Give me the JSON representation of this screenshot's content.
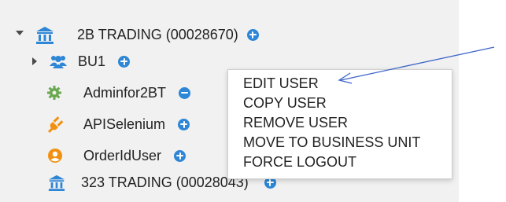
{
  "tree": {
    "company1": {
      "label": "2B TRADING (00028670)",
      "icon": "bank-icon",
      "expanded": true,
      "children": {
        "bu1": {
          "label": "BU1",
          "icon": "users-group-icon",
          "expanded": false
        },
        "user_admin": {
          "label": "Adminfor2BT",
          "icon": "gear-icon"
        },
        "user_api": {
          "label": "APISelenium",
          "icon": "plug-icon"
        },
        "user_order": {
          "label": "OrderIdUser",
          "icon": "user-icon"
        }
      }
    },
    "company2": {
      "label": "323 TRADING (00028043)",
      "icon": "bank-icon"
    }
  },
  "context_menu": {
    "items": [
      "EDIT USER",
      "COPY USER",
      "REMOVE USER",
      "MOVE TO BUSINESS UNIT",
      "FORCE LOGOUT"
    ]
  },
  "colors": {
    "accent": "#2e86d6",
    "bank_icon": "#2e86d6",
    "gear_icon": "#6aa84f",
    "plug_icon": "#f29111",
    "user_icon": "#f29111",
    "arrow": "#3c64c8",
    "panel_background": "#f1f1f1"
  }
}
